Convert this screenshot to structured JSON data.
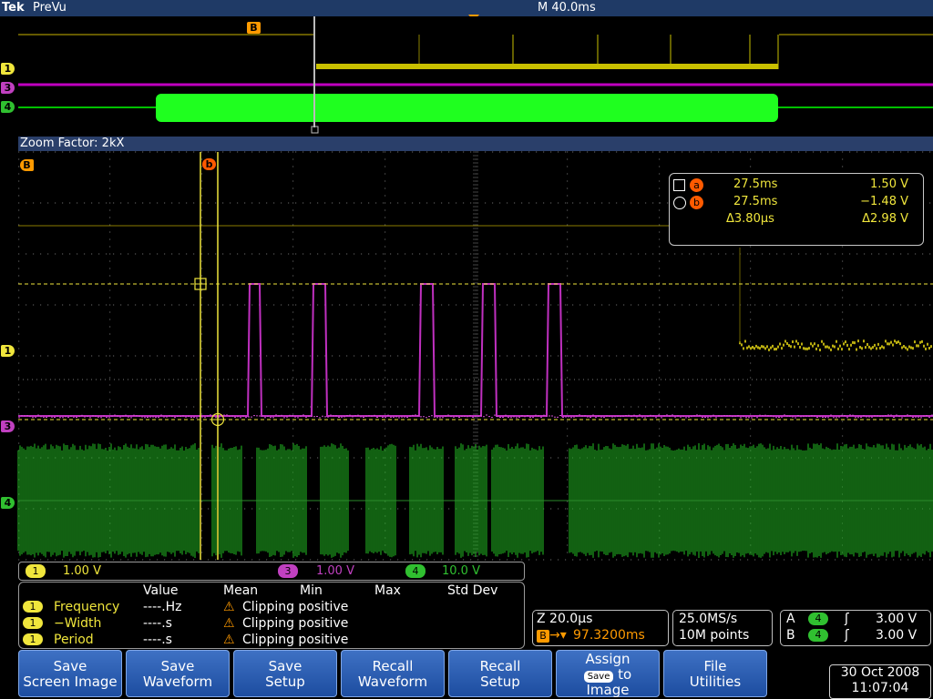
{
  "header": {
    "brand": "Tek",
    "mode": "PreVu",
    "timebase": "M 40.0ms"
  },
  "zoom": {
    "label": "Zoom Factor: 2kX"
  },
  "markers": {
    "ch1": "1",
    "ch3": "3",
    "ch4": "4",
    "b_overview": "B",
    "b_zoom": "B",
    "cursor_b": "b"
  },
  "cursors": {
    "a": {
      "label": "a",
      "time": "27.5ms",
      "volt": "1.50 V"
    },
    "b": {
      "label": "b",
      "time": "27.5ms",
      "volt": "−1.48 V"
    },
    "delta": {
      "time": "Δ3.80µs",
      "volt": "Δ2.98 V"
    }
  },
  "channels": [
    {
      "num": "1",
      "scale": "1.00 V",
      "color": "#f0e63c"
    },
    {
      "num": "3",
      "scale": "1.00 V",
      "color": "#c040c0"
    },
    {
      "num": "4",
      "scale": "10.0 V",
      "color": "#30c030"
    }
  ],
  "measurements": {
    "headers": [
      "Value",
      "Mean",
      "Min",
      "Max",
      "Std Dev"
    ],
    "rows": [
      {
        "ch": "1",
        "name": "Frequency",
        "value": "----.Hz",
        "status": "Clipping positive"
      },
      {
        "ch": "1",
        "name": "−Width",
        "value": "----.s",
        "status": "Clipping positive"
      },
      {
        "ch": "1",
        "name": "Period",
        "value": "----.s",
        "status": "Clipping positive"
      }
    ]
  },
  "zoom_info": {
    "scale": "Z 20.0µs",
    "position": "97.3200ms",
    "position_marker": "B"
  },
  "acq": {
    "rate": "25.0MS/s",
    "points": "10M points"
  },
  "trigger": {
    "a": {
      "label": "A",
      "ch": "4",
      "level": "3.00 V"
    },
    "b": {
      "label": "B",
      "ch": "4",
      "level": "3.00 V"
    }
  },
  "buttons": {
    "save_screen": [
      "Save",
      "Screen Image"
    ],
    "save_waveform": [
      "Save",
      "Waveform"
    ],
    "save_setup": [
      "Save",
      "Setup"
    ],
    "recall_waveform": [
      "Recall",
      "Waveform"
    ],
    "recall_setup": [
      "Recall",
      "Setup"
    ],
    "assign": [
      "Assign",
      "Save",
      "to",
      "Image"
    ],
    "file_utilities": [
      "File",
      "Utilities"
    ]
  },
  "datetime": {
    "date": "30 Oct  2008",
    "time": "11:07:04"
  }
}
